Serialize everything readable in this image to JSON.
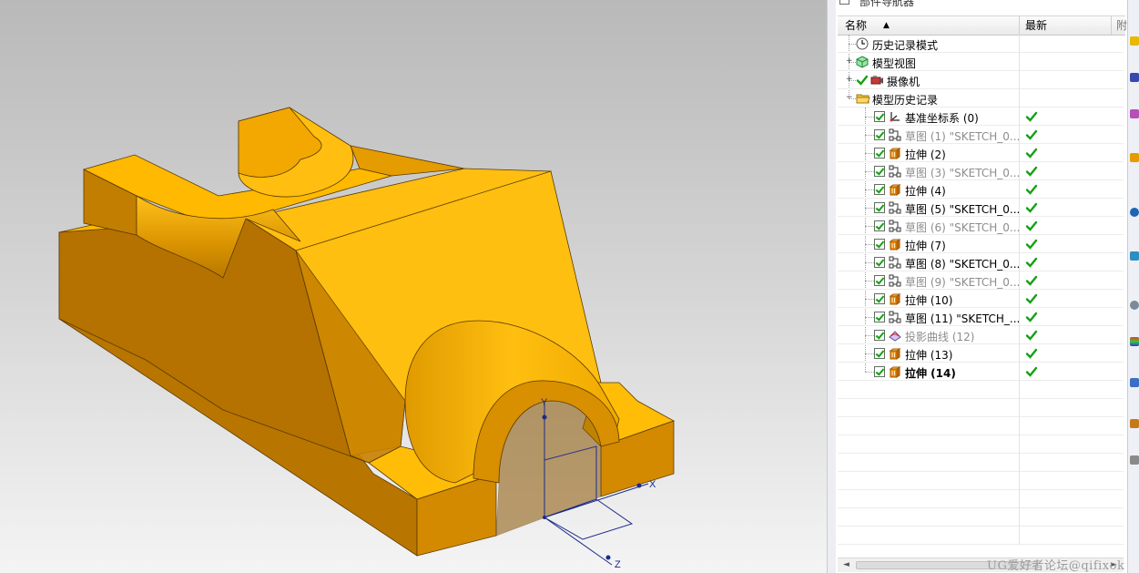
{
  "part_navigator": {
    "title": "部件导航器",
    "columns": {
      "name": "名称",
      "latest": "最新"
    },
    "items": [
      {
        "label": "历史记录模式",
        "icon": "clock-icon",
        "level": 0,
        "expander": "",
        "checked": false,
        "status": "",
        "gray": false,
        "bold": false
      },
      {
        "label": "模型视图",
        "icon": "model-views-icon",
        "level": 0,
        "expander": "+",
        "checked": false,
        "status": "",
        "gray": false,
        "bold": false
      },
      {
        "label": "摄像机",
        "icon": "camera-icon",
        "level": 0,
        "expander": "+",
        "checked": false,
        "status": "",
        "gray": false,
        "bold": false
      },
      {
        "label": "模型历史记录",
        "icon": "folder-icon",
        "level": 0,
        "expander": "−",
        "checked": false,
        "status": "",
        "gray": false,
        "bold": false
      },
      {
        "label": "基准坐标系 (0)",
        "icon": "datum-csys-icon",
        "level": 1,
        "checked": true,
        "status": "ok",
        "gray": false,
        "bold": false
      },
      {
        "label": "草图 (1) \"SKETCH_0...",
        "icon": "sketch-icon",
        "level": 1,
        "checked": true,
        "status": "ok",
        "gray": true,
        "bold": false
      },
      {
        "label": "拉伸 (2)",
        "icon": "extrude-icon",
        "level": 1,
        "checked": true,
        "status": "ok",
        "gray": false,
        "bold": false
      },
      {
        "label": "草图 (3) \"SKETCH_0...",
        "icon": "sketch-icon",
        "level": 1,
        "checked": true,
        "status": "ok",
        "gray": true,
        "bold": false
      },
      {
        "label": "拉伸 (4)",
        "icon": "extrude-icon",
        "level": 1,
        "checked": true,
        "status": "ok",
        "gray": false,
        "bold": false
      },
      {
        "label": "草图 (5) \"SKETCH_0...",
        "icon": "sketch-icon",
        "level": 1,
        "checked": true,
        "status": "ok",
        "gray": false,
        "bold": false
      },
      {
        "label": "草图 (6) \"SKETCH_0...",
        "icon": "sketch-icon",
        "level": 1,
        "checked": true,
        "status": "ok",
        "gray": true,
        "bold": false
      },
      {
        "label": "拉伸 (7)",
        "icon": "extrude-icon",
        "level": 1,
        "checked": true,
        "status": "ok",
        "gray": false,
        "bold": false
      },
      {
        "label": "草图 (8) \"SKETCH_0...",
        "icon": "sketch-icon",
        "level": 1,
        "checked": true,
        "status": "ok",
        "gray": false,
        "bold": false
      },
      {
        "label": "草图 (9) \"SKETCH_0...",
        "icon": "sketch-icon",
        "level": 1,
        "checked": true,
        "status": "ok",
        "gray": true,
        "bold": false
      },
      {
        "label": "拉伸 (10)",
        "icon": "extrude-icon",
        "level": 1,
        "checked": true,
        "status": "ok",
        "gray": false,
        "bold": false
      },
      {
        "label": "草图 (11) \"SKETCH_...",
        "icon": "sketch-icon",
        "level": 1,
        "checked": true,
        "status": "ok",
        "gray": false,
        "bold": false
      },
      {
        "label": "投影曲线 (12)",
        "icon": "projected-curve-icon",
        "level": 1,
        "checked": true,
        "status": "ok",
        "gray": true,
        "bold": false
      },
      {
        "label": "拉伸 (13)",
        "icon": "extrude-icon",
        "level": 1,
        "checked": true,
        "status": "ok",
        "gray": false,
        "bold": false
      },
      {
        "label": "拉伸 (14)",
        "icon": "extrude-icon",
        "level": 1,
        "checked": true,
        "status": "ok",
        "gray": false,
        "bold": true
      }
    ]
  },
  "viewport": {
    "axes": {
      "x": "X",
      "y": "Y",
      "z": "Z"
    }
  },
  "watermark": "UG爱好者论坛@qifixok",
  "colors": {
    "part": "#ffb800",
    "check": "#14a014",
    "axis": "#1b2a8a"
  }
}
